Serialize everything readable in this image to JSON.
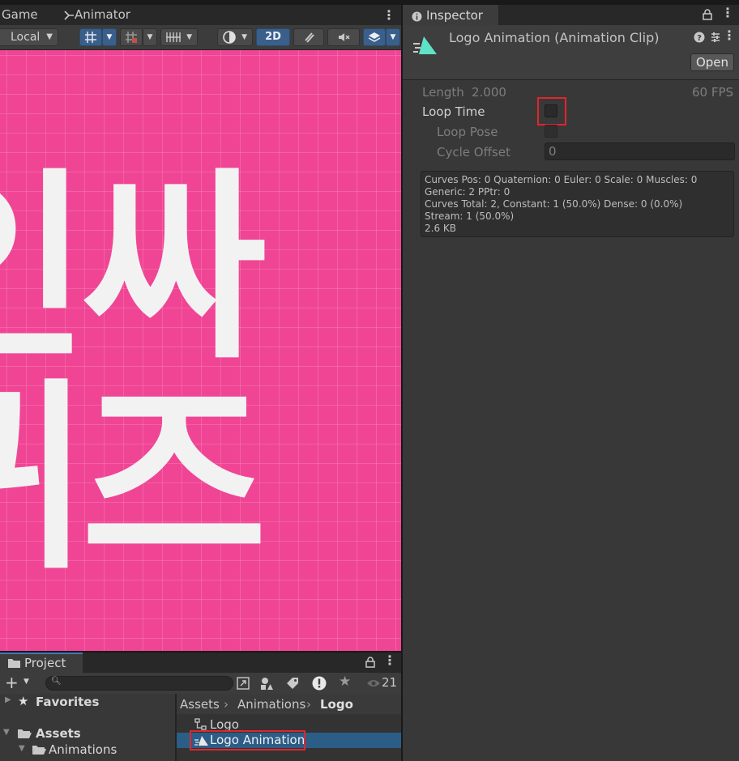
{
  "scene": {
    "tabs": {
      "game": "Game",
      "animator": "Animator"
    },
    "toolbar": {
      "pivot_space": "Local",
      "mode_2d": "2D"
    },
    "canvas_text": {
      "line1": "인싸",
      "line2": "퀴즈"
    }
  },
  "inspector": {
    "tab_label": "Inspector",
    "title": "Logo Animation (Animation Clip)",
    "open_button": "Open",
    "length_label": "Length",
    "length_value": "2.000",
    "fps": "60 FPS",
    "loop_time_label": "Loop Time",
    "loop_time_checked": false,
    "loop_pose_label": "Loop Pose",
    "cycle_offset_label": "Cycle Offset",
    "cycle_offset_value": "0",
    "info": [
      "Curves Pos: 0 Quaternion: 0 Euler: 0 Scale: 0 Muscles: 0",
      "Generic: 2 PPtr: 0",
      "Curves Total: 2, Constant: 1 (50.0%) Dense: 0 (0.0%)",
      "Stream: 1 (50.0%)",
      "2.6 KB"
    ],
    "accent_color": "#5fe3c8"
  },
  "project": {
    "tab_label": "Project",
    "search_placeholder": "",
    "visibility_count": "21",
    "tree": {
      "favorites": "Favorites",
      "assets": "Assets",
      "animations": "Animations"
    },
    "breadcrumb": {
      "part1": "Assets",
      "part2": "Animations",
      "part3": "Logo"
    },
    "items": [
      {
        "label": "Logo",
        "selected": false
      },
      {
        "label": "Logo Animation",
        "selected": true
      }
    ],
    "selection_color": "#2c5d87"
  },
  "highlight_color": "#e0262b"
}
